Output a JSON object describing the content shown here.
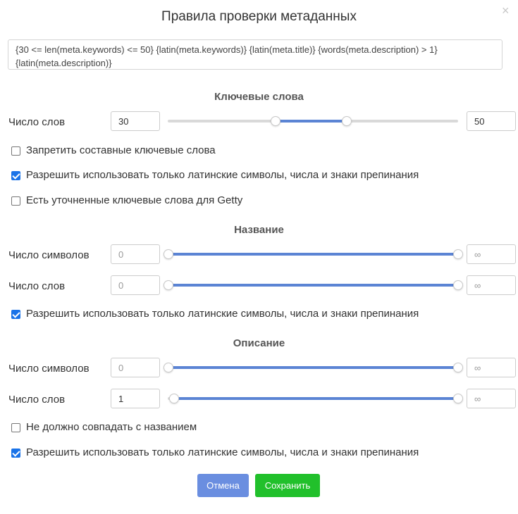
{
  "dialog": {
    "title": "Правила проверки метаданных",
    "close_glyph": "×",
    "expression": "{30 <= len(meta.keywords) <= 50} {latin(meta.keywords)} {latin(meta.title)} {words(meta.description) > 1} {latin(meta.description)}"
  },
  "keywords": {
    "heading": "Ключевые слова",
    "word_count": {
      "label": "Число слов",
      "min": "30",
      "max": "50",
      "range_fraction": [
        0.367,
        0.617
      ]
    },
    "options": [
      {
        "label": "Запретить составные ключевые слова",
        "checked": false
      },
      {
        "label": "Разрешить использовать только латинские символы, числа и знаки препинания",
        "checked": true
      },
      {
        "label": "Есть уточненные ключевые слова для Getty",
        "checked": false
      }
    ]
  },
  "title_section": {
    "heading": "Название",
    "char_count": {
      "label": "Число символов",
      "min": "0",
      "max": "∞",
      "range_fraction": [
        0,
        1
      ]
    },
    "word_count": {
      "label": "Число слов",
      "min": "0",
      "max": "∞",
      "range_fraction": [
        0,
        1
      ]
    },
    "options": [
      {
        "label": "Разрешить использовать только латинские символы, числа и знаки препинания",
        "checked": true
      }
    ]
  },
  "description": {
    "heading": "Описание",
    "char_count": {
      "label": "Число символов",
      "min": "0",
      "max": "∞",
      "range_fraction": [
        0,
        1
      ]
    },
    "word_count": {
      "label": "Число слов",
      "min": "1",
      "max": "∞",
      "range_fraction": [
        0.02,
        1
      ]
    },
    "options": [
      {
        "label": "Не должно совпадать с названием",
        "checked": false
      },
      {
        "label": "Разрешить использовать только латинские символы, числа и знаки препинания",
        "checked": true
      }
    ]
  },
  "buttons": {
    "cancel": "Отмена",
    "save": "Сохранить"
  },
  "colors": {
    "accent": "#5b84d4",
    "checkbox": "#1a73e8",
    "cancel": "#6a8ee0",
    "save": "#21c02b"
  }
}
